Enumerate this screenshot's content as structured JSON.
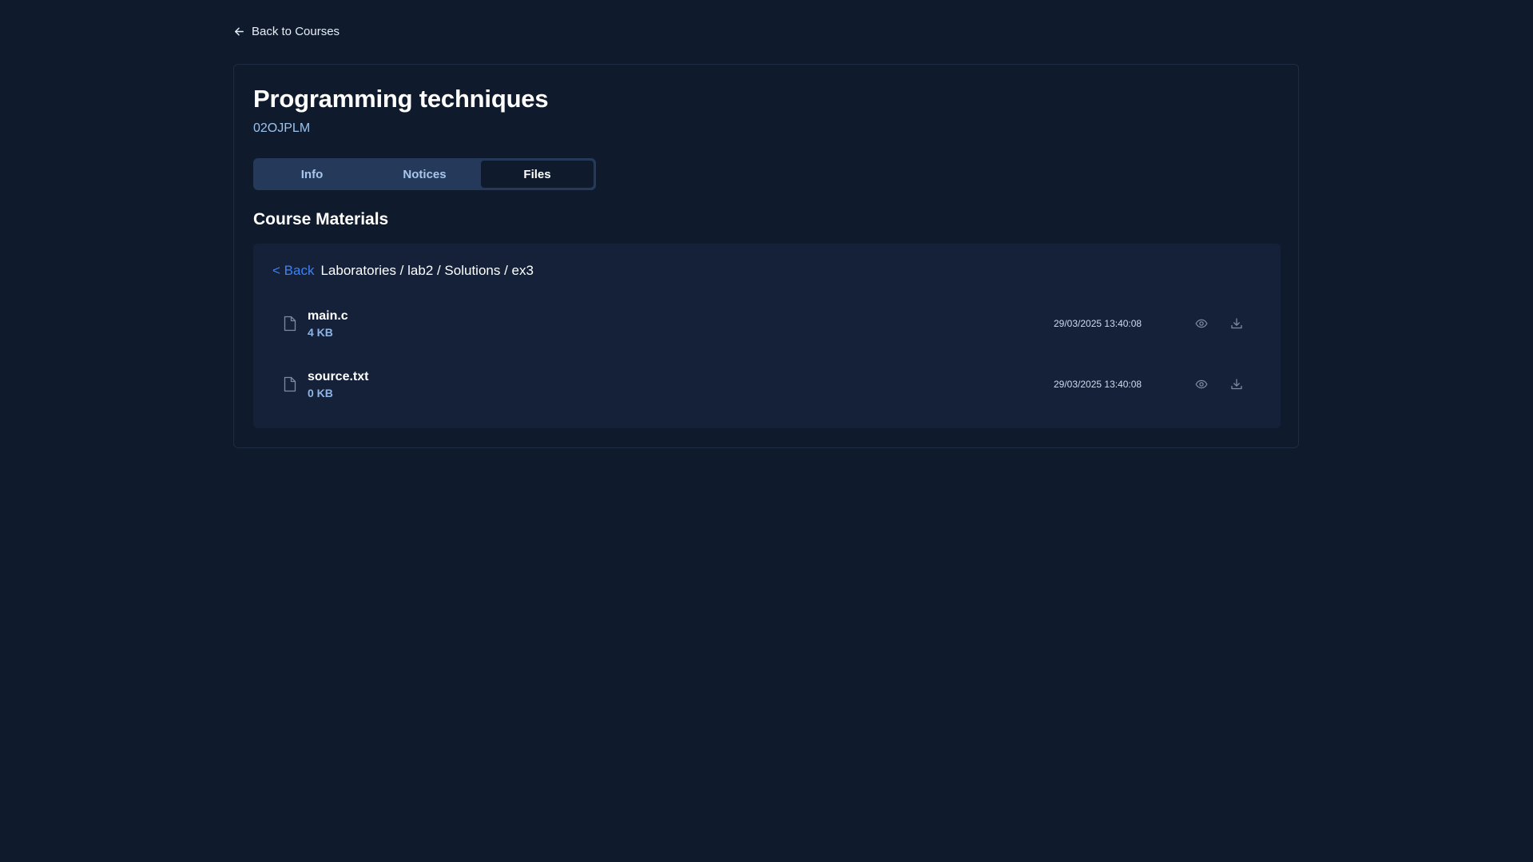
{
  "nav": {
    "back_label": "Back to Courses"
  },
  "course": {
    "title": "Programming techniques",
    "code": "02OJPLM"
  },
  "tabs": [
    {
      "label": "Info",
      "active": false
    },
    {
      "label": "Notices",
      "active": false
    },
    {
      "label": "Files",
      "active": true
    }
  ],
  "materials": {
    "title": "Course Materials",
    "back_label": "< Back",
    "path": "Laboratories / lab2 / Solutions / ex3",
    "files": [
      {
        "name": "main.c",
        "size": "4 KB",
        "date": "29/03/2025 13:40:08",
        "icon": "file-icon"
      },
      {
        "name": "source.txt",
        "size": "0 KB",
        "date": "29/03/2025 13:40:08",
        "icon": "file-icon"
      }
    ]
  },
  "colors": {
    "background": "#0f1b2d",
    "panel": "#142139",
    "tabs_bg": "#253a5a",
    "accent_link": "#3b82f6",
    "code_text": "#9cc3ec"
  }
}
